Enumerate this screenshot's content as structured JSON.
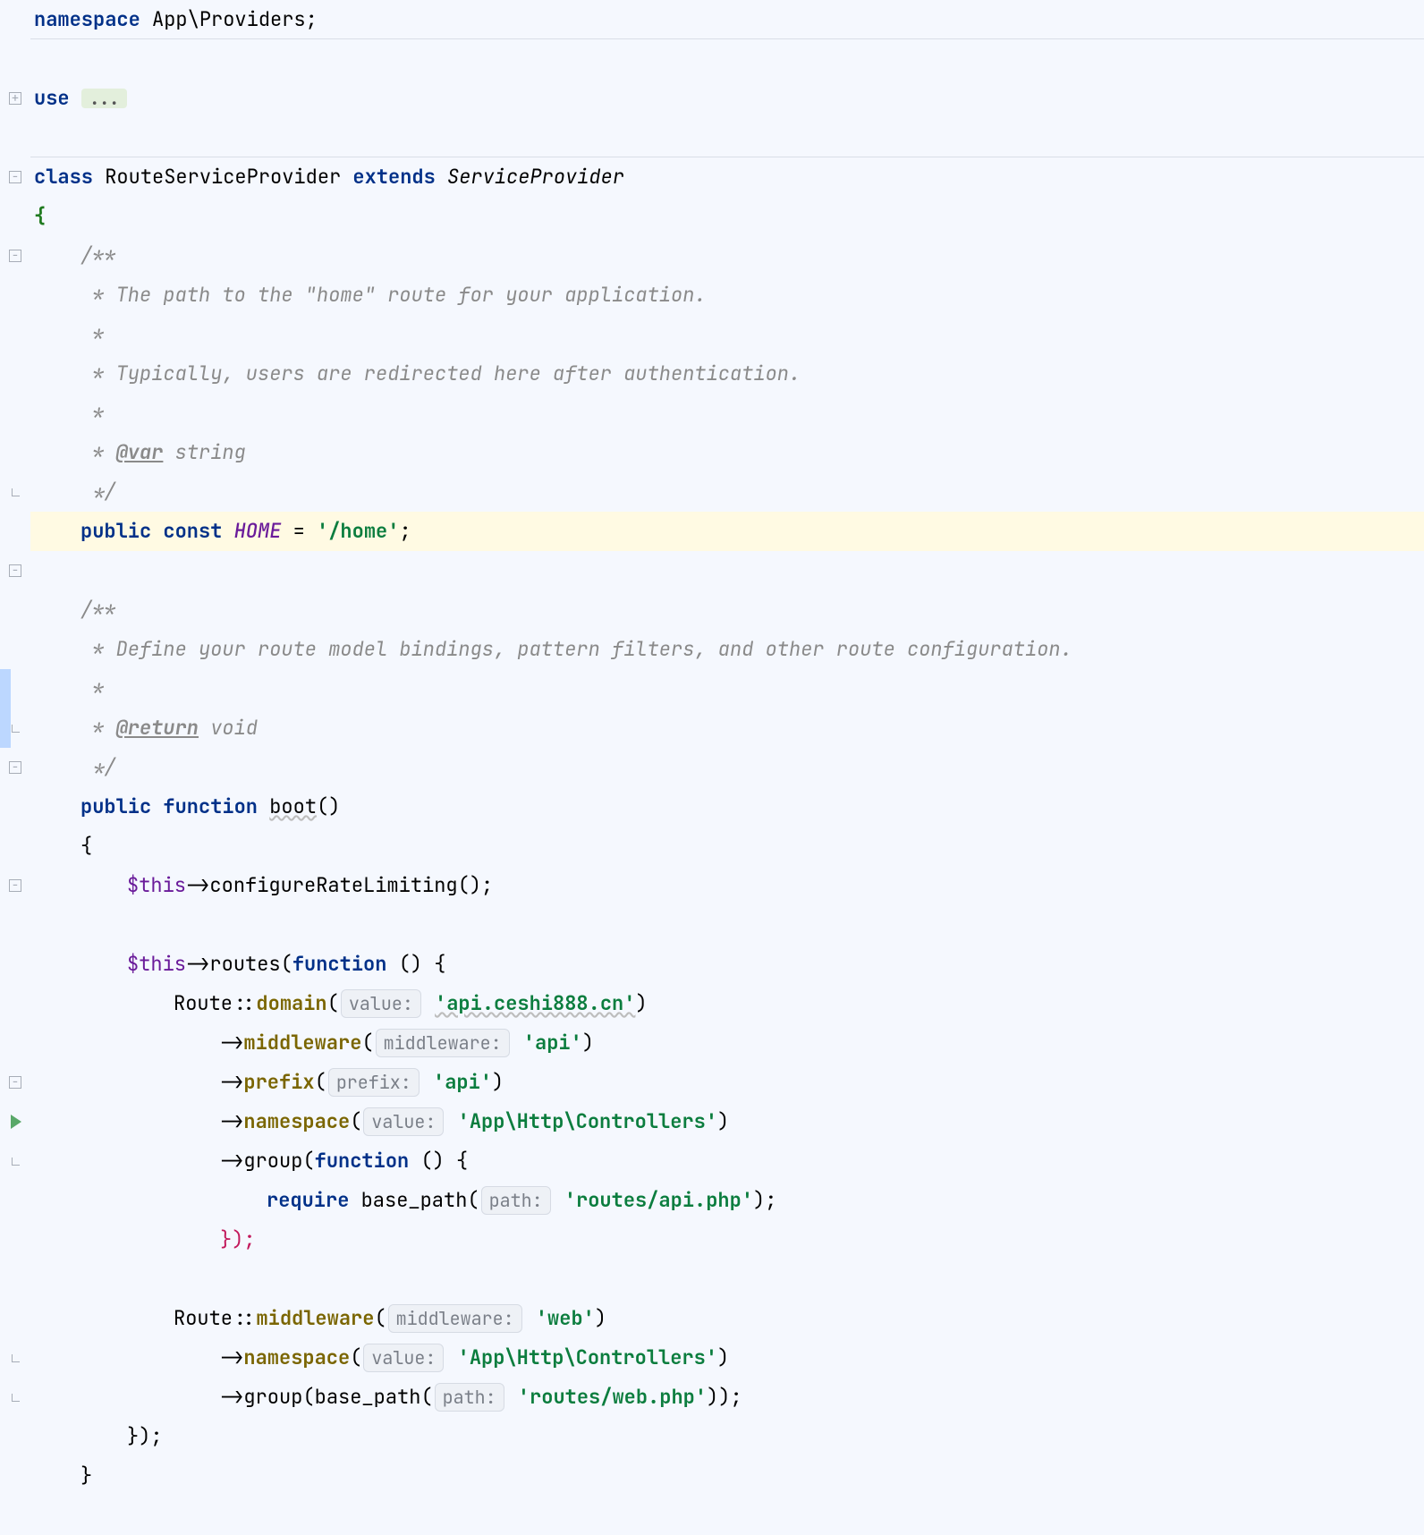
{
  "code": {
    "namespace_kw": "namespace",
    "namespace_val": " App\\Providers;",
    "use_kw": "use",
    "use_folded": "...",
    "class_kw": "class",
    "class_name": " RouteServiceProvider ",
    "extends_kw": "extends",
    "parent_class": " ServiceProvider",
    "open_brace": "{",
    "close_brace": "}",
    "doc1_open": "/**",
    "doc1_l1": " * The path to the \"home\" route for your application.",
    "doc1_l2": " *",
    "doc1_l3": " * Typically, users are redirected here after authentication.",
    "doc1_l4": " *",
    "doc1_tag_pre": " * ",
    "doc1_tag": "@var",
    "doc1_tag_post": " string",
    "doc1_close": " */",
    "home_public": "public ",
    "home_const": "const ",
    "home_name": "HOME",
    "home_eq": " = ",
    "home_val": "'/home'",
    "home_semi": ";",
    "doc2_open": "/**",
    "doc2_l1": " * Define your route model bindings, pattern filters, and other route configuration.",
    "doc2_l2": " *",
    "doc2_tag_pre": " * ",
    "doc2_tag": "@return",
    "doc2_tag_post": " void",
    "doc2_close": " */",
    "boot_public": "public ",
    "boot_function": "function ",
    "boot_name": "boot",
    "boot_parens": "()",
    "boot_open": "{",
    "boot_close": "}",
    "crl_this": "$this",
    "crl_arrow": "->",
    "crl_fn": "configureRateLimiting",
    "crl_tail": "();",
    "routes_fn": "routes",
    "routes_args_pre": "(",
    "routes_fn_kw": "function",
    "routes_fn_par": " () {",
    "route_static": "Route",
    "dbl_colon": "::",
    "domain_fn": "domain",
    "domain_hint": "value:",
    "domain_val": "'api.ceshi888.cn'",
    "rparen": ")",
    "mw_fn": "middleware",
    "mw_hint": "middleware:",
    "mw_val_api": "'api'",
    "mw_val_web": "'web'",
    "prefix_fn": "prefix",
    "prefix_hint": "prefix:",
    "prefix_val": "'api'",
    "ns_fn": "namespace",
    "ns_hint": "value:",
    "ns_val": "'App\\Http\\Controllers'",
    "group_fn": "group",
    "group_fn_kw": "function",
    "group_fn_par": " () {",
    "require_kw": "require",
    "basepath_fn": " base_path",
    "bp_open": "(",
    "bp_hint": "path:",
    "bp_val_api": "'routes/api.php'",
    "bp_val_web": "'routes/web.php'",
    "bp_close_semi": ");",
    "close_brace_paren_semi": "});",
    "close_paren_paren_semi": "));",
    "arrow": "->"
  },
  "gutter": {
    "fold_icon": "fold",
    "run_icon": "run"
  }
}
